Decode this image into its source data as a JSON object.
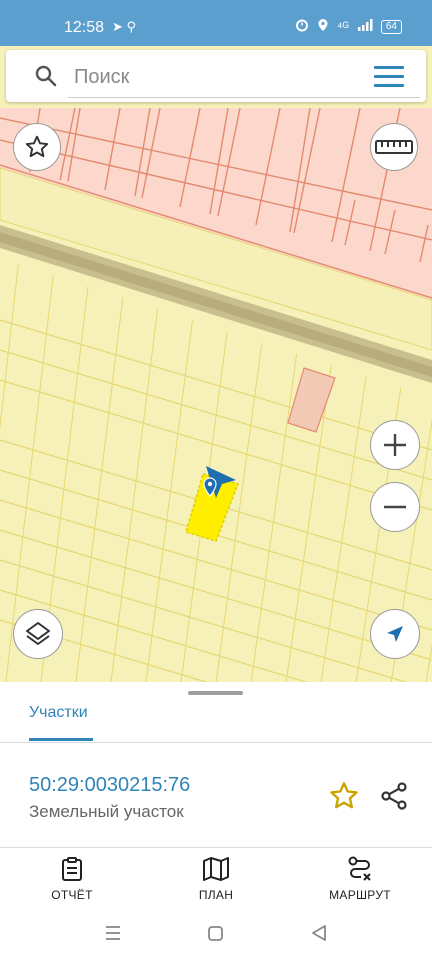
{
  "status_bar": {
    "time": "12:58",
    "left_icons": "➤ ⚲",
    "network": "⁴ᴳ",
    "battery": "64"
  },
  "search": {
    "placeholder": "Поиск"
  },
  "map": {
    "colors": {
      "parcel_fill": "#f6f1b9",
      "parcel_line": "#e6d770",
      "urban_fill": "#fbd8cb",
      "urban_line": "#e48970",
      "road_fill": "#c9bf8e",
      "selected_parcel": "#ffee00",
      "accent": "#2f84b8"
    }
  },
  "sheet": {
    "tab_label": "Участки",
    "parcel_number": "50:29:0030215:76",
    "parcel_type": "Земельный участок"
  },
  "bottom_nav": {
    "report": "ОТЧЁТ",
    "plan": "ПЛАН",
    "route": "МАРШРУТ"
  },
  "icons": [
    "search-icon",
    "menu-icon",
    "star-icon",
    "ruler-icon",
    "plus-icon",
    "minus-icon",
    "layers-icon",
    "navigation-arrow-icon",
    "share-icon",
    "clipboard-icon",
    "map-icon",
    "route-icon"
  ]
}
